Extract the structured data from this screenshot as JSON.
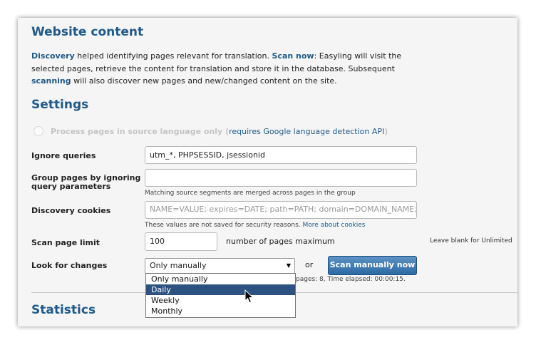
{
  "website_content": {
    "title": "Website content",
    "intro": {
      "discovery_link": "Discovery",
      "part1": " helped identifying pages relevant for translation. ",
      "scan_now_link": "Scan now",
      "part2": ": Easyling will visit the selected pages, retrieve the content for translation and store it in the database. Subsequent ",
      "scanning_link": "scanning",
      "part3": " will also discover new pages and new/changed content on the site."
    }
  },
  "settings": {
    "title": "Settings",
    "process_source_only": {
      "label": "Process pages in source language only (",
      "link": "requires Google language detection API",
      "close": ")"
    },
    "ignore_queries": {
      "label": "Ignore queries",
      "value": "utm_*, PHPSESSID, jsessionid"
    },
    "group_pages": {
      "label_line1": "Group pages by ignoring",
      "label_line2": "query parameters",
      "value": "",
      "hint": "Matching source segments are merged across pages in the group"
    },
    "discovery_cookies": {
      "label": "Discovery cookies",
      "placeholder": "NAME=VALUE; expires=DATE; path=PATH; domain=DOMAIN_NAME; secure",
      "hint": "These values are not saved for security reasons. ",
      "hint_link": "More about cookies"
    },
    "scan_page_limit": {
      "label": "Scan page limit",
      "value": "100",
      "suffix": "number of pages maximum",
      "note": "Leave blank for Unlimited"
    },
    "look_for_changes": {
      "label": "Look for changes",
      "selected": "Only manually",
      "or": "or",
      "button": "Scan manually now",
      "status_partial": "pages: 8, Time elapsed: 00:00:15.",
      "options": [
        "Only manually",
        "Daily",
        "Weekly",
        "Monthly"
      ],
      "highlighted_index": 1
    }
  },
  "statistics": {
    "title": "Statistics"
  },
  "icons": {
    "caret": "caret-down-icon",
    "cursor": "mouse-pointer-icon"
  },
  "colors": {
    "heading": "#1f5a8a",
    "link": "#1f5a8a",
    "button": "#2c6aa4",
    "highlight": "#2c5281"
  }
}
